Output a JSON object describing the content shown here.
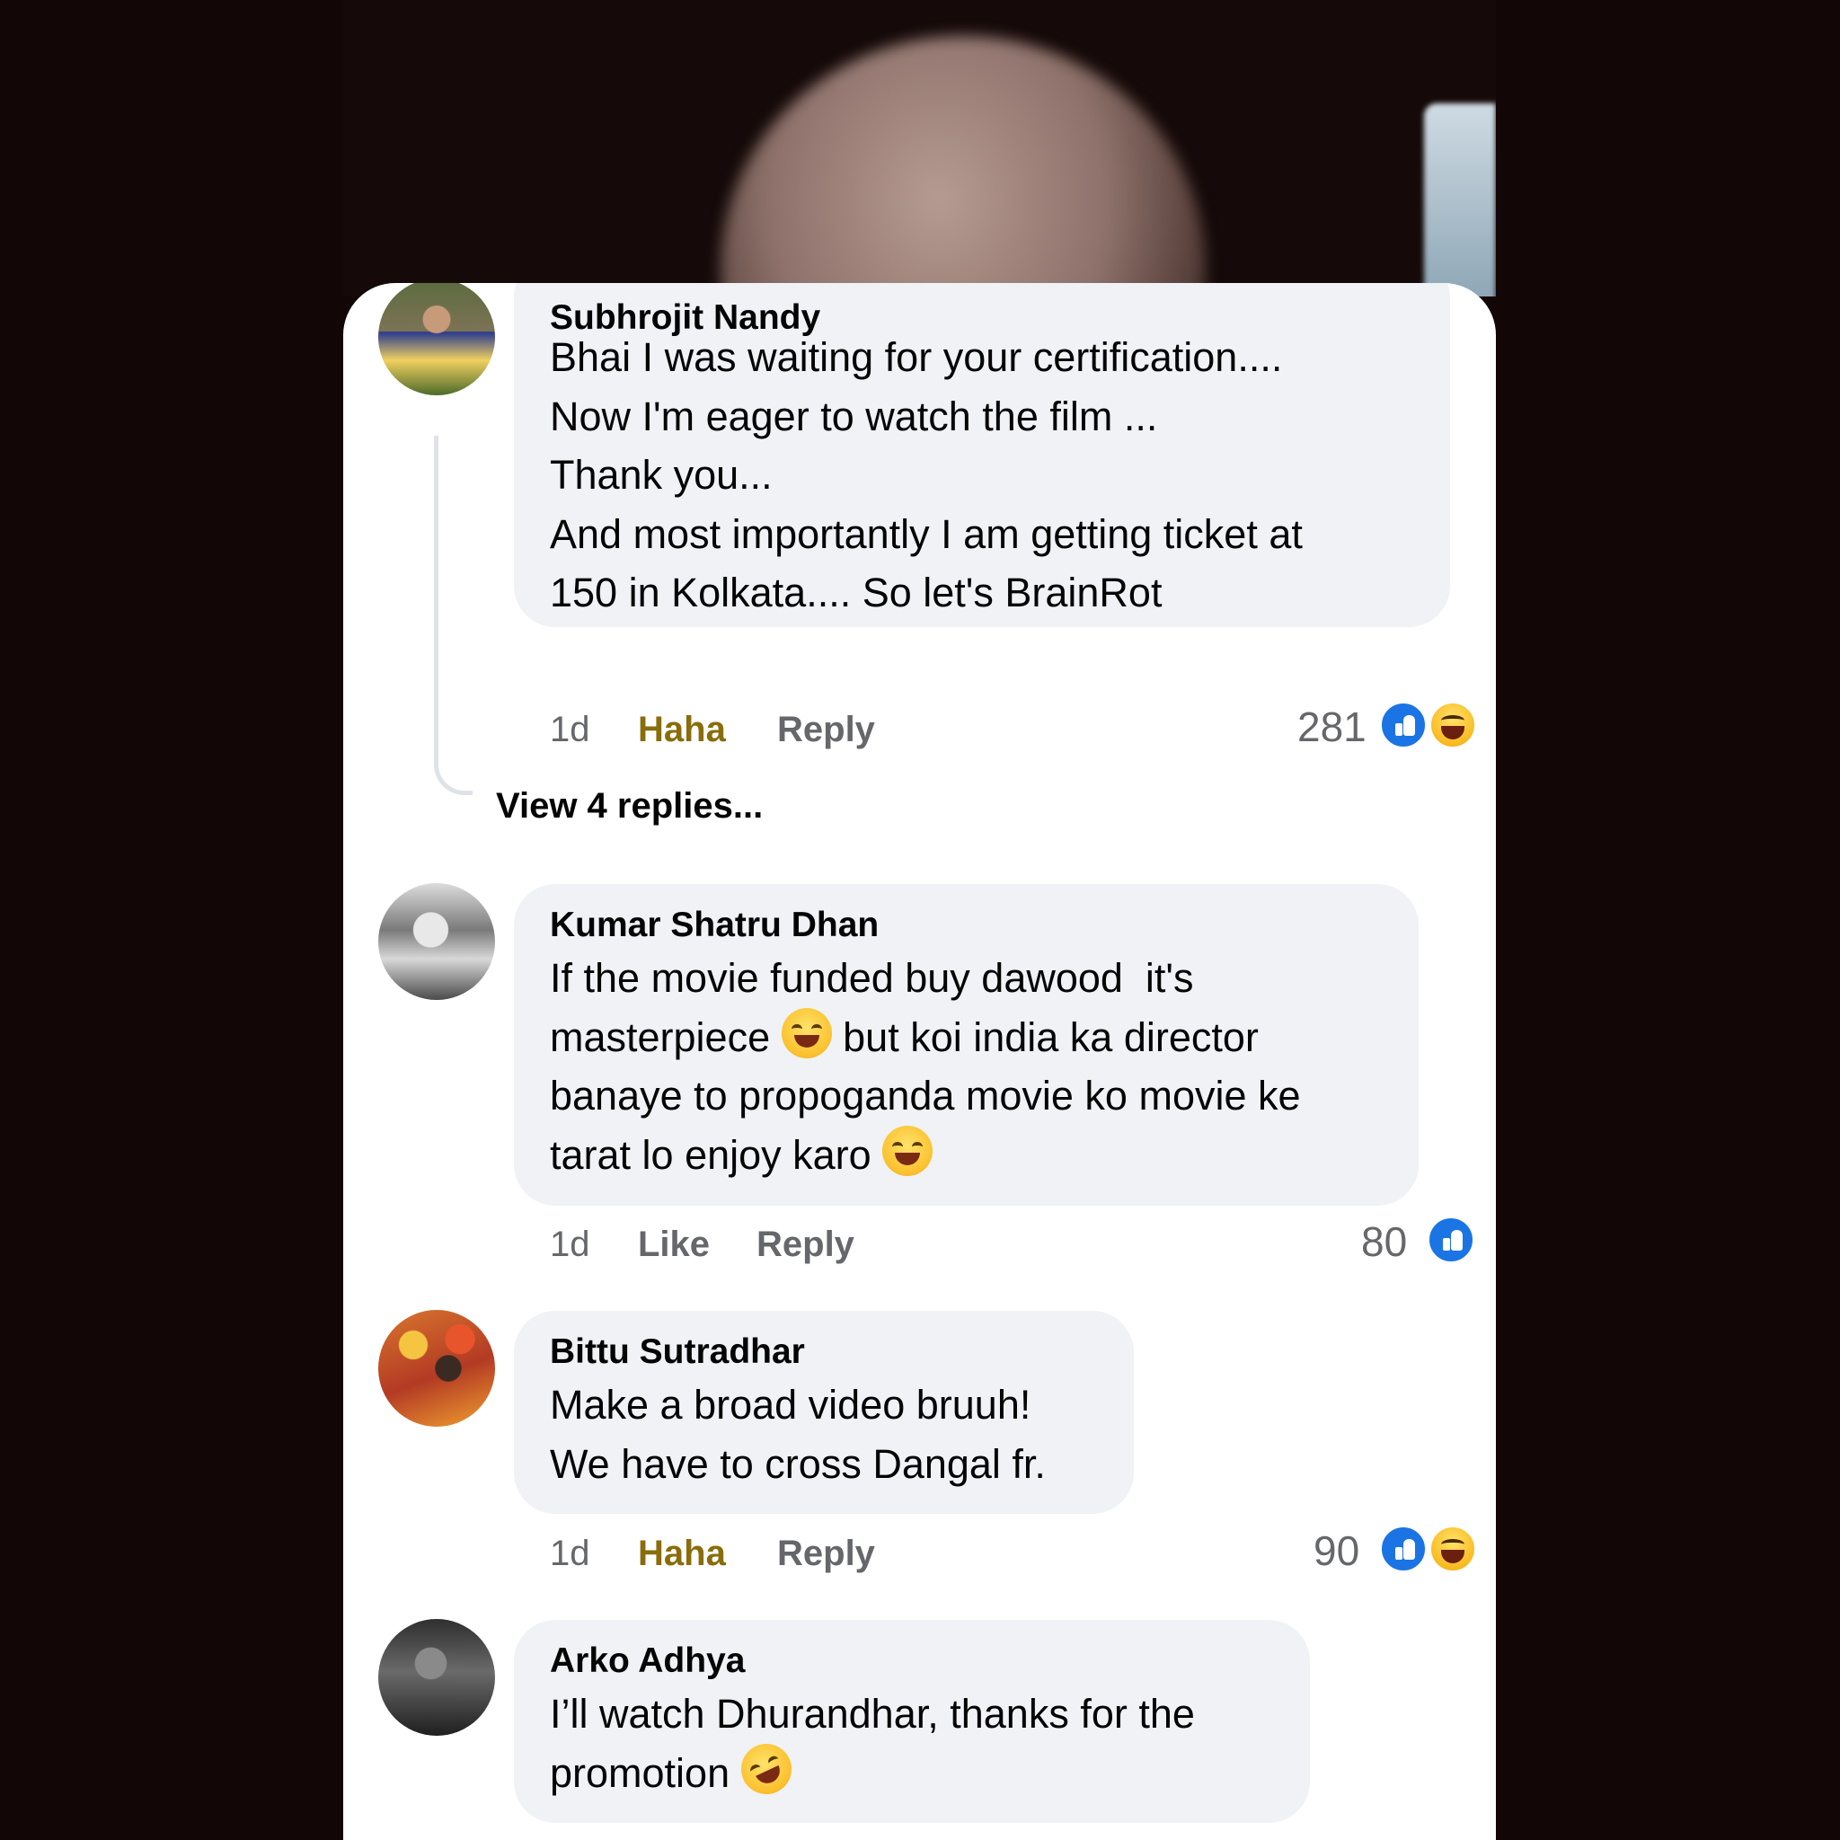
{
  "comments": [
    {
      "author": "Subhrojit Nandy",
      "lines": [
        "Bhai I was waiting for your certification....",
        "Now I'm eager to watch the film ...",
        "Thank you...",
        "And most importantly I am getting ticket at",
        "150 in Kolkata.... So let's BrainRot"
      ],
      "time": "1d",
      "reaction_label": "Haha",
      "reply_label": "Reply",
      "reaction_count": "281",
      "reactions": [
        "like-icon",
        "haha-icon"
      ]
    },
    {
      "author": "Kumar Shatru Dhan",
      "lines": [
        "If the movie funded buy dawood  it's",
        "masterpiece",
        "but koi india ka director",
        "banaye to propoganda movie ko movie ke",
        "tarat lo enjoy karo"
      ],
      "time": "1d",
      "reaction_label": "Like",
      "reply_label": "Reply",
      "reaction_count": "80",
      "reactions": [
        "like-icon"
      ]
    },
    {
      "author": "Bittu Sutradhar",
      "lines": [
        "Make a broad video bruuh!",
        "We have to cross Dangal fr."
      ],
      "time": "1d",
      "reaction_label": "Haha",
      "reply_label": "Reply",
      "reaction_count": "90",
      "reactions": [
        "like-icon",
        "haha-icon"
      ]
    },
    {
      "author": "Arko Adhya",
      "lines": [
        "I’ll watch Dhurandhar, thanks for the",
        "promotion"
      ]
    }
  ],
  "view_replies": "View 4 replies...",
  "colors": {
    "bubble": "#f0f2f5",
    "like": "#1b74e4",
    "haha_text": "#8a6d0b",
    "meta": "#65676b"
  }
}
